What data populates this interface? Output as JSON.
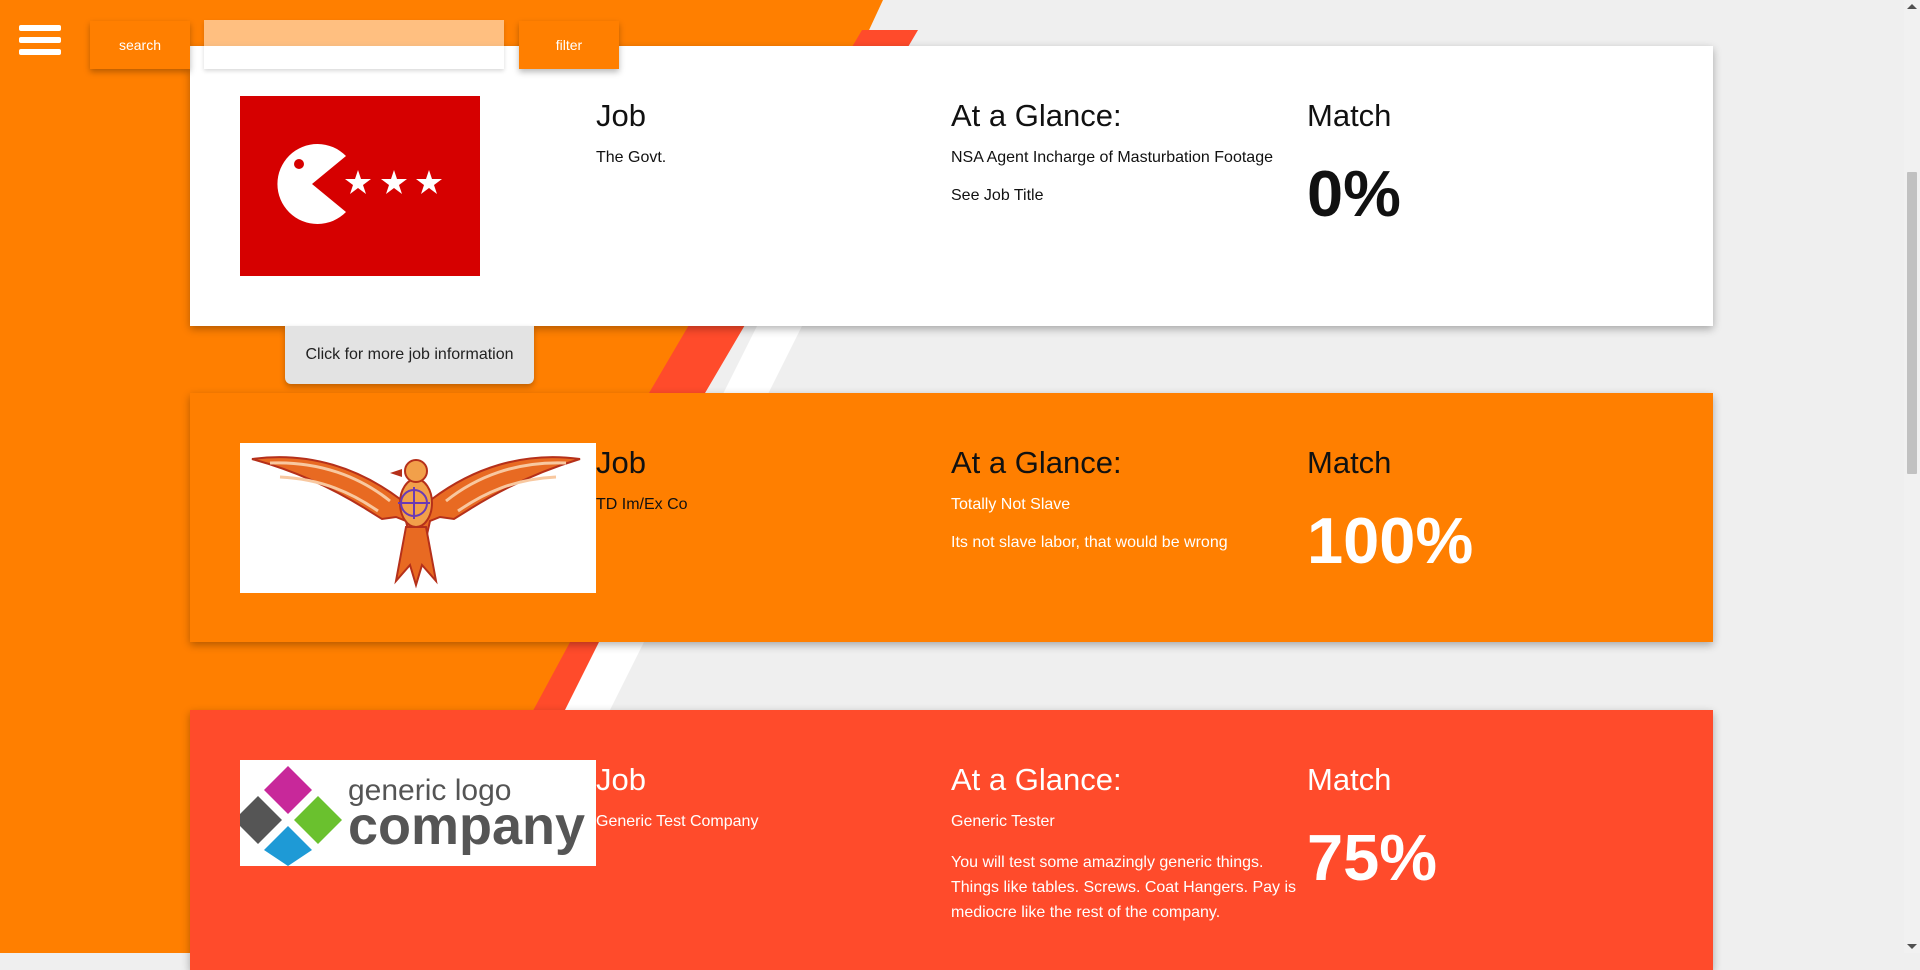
{
  "toolbar": {
    "search_label": "search",
    "search_placeholder": "",
    "filter_label": "filter"
  },
  "colors": {
    "orange": "#ff7f00",
    "red_orange": "#ff4b2b",
    "white": "#ffffff"
  },
  "jobs": [
    {
      "company": "The Govt.",
      "job_header": "Job",
      "glance_header": "At a Glance:",
      "title": "NSA Agent Incharge of Masturbation Footage",
      "description": "See Job Title",
      "match_header": "Match",
      "match": "0%",
      "logo": "red-flag-pacman-logo",
      "card_color": "#ffffff"
    },
    {
      "company": "TD Im/Ex Co",
      "job_header": "Job",
      "glance_header": "At a Glance:",
      "title": "Totally Not Slave",
      "description": "Its not slave labor, that would be wrong",
      "match_header": "Match",
      "match": "100%",
      "logo": "phoenix-logo",
      "card_color": "#ff7f00"
    },
    {
      "company": "Generic Test Company",
      "job_header": "Job",
      "glance_header": "At a Glance:",
      "title": "Generic Tester",
      "description": "You will test some amazingly generic things. Things like tables. Screws. Coat Hangers. Pay is mediocre like the rest of the company.",
      "match_header": "Match",
      "match": "75%",
      "logo": "generic-logo-company",
      "logo_text_top": "generic logo",
      "logo_text_bottom": "company",
      "card_color": "#ff4b2b"
    }
  ],
  "more_info_label": "Click for more job information"
}
